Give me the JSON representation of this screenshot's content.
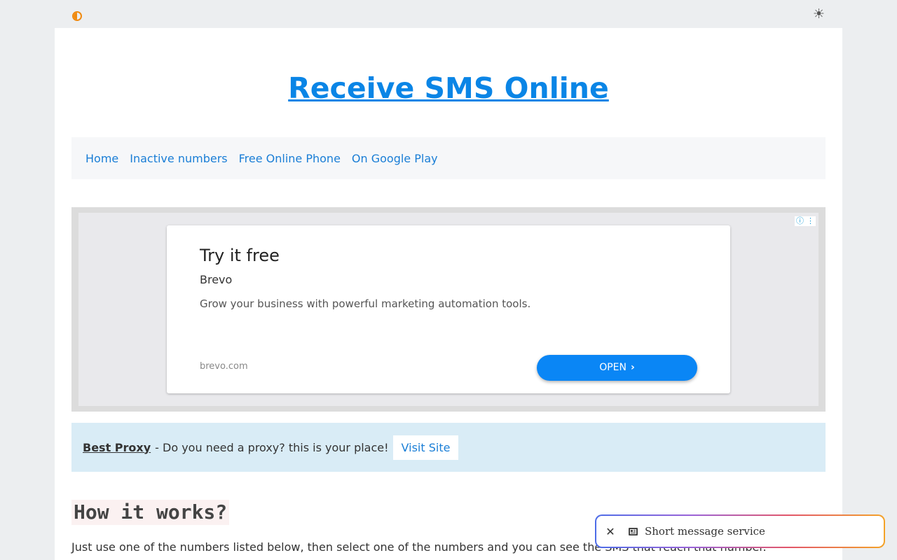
{
  "icons": {
    "contrast": "contrast-icon",
    "theme": "sun-icon",
    "close": "close-icon",
    "article": "article-icon"
  },
  "theme_toggle": {
    "glyph": "☀"
  },
  "header": {
    "title": "Receive SMS Online"
  },
  "nav": {
    "items": [
      {
        "label": "Home"
      },
      {
        "label": "Inactive numbers"
      },
      {
        "label": "Free Online Phone"
      },
      {
        "label": "On Google Play"
      }
    ]
  },
  "ad": {
    "choices_info": "ⓘ",
    "choices_menu": "⋮",
    "headline": "Try it free",
    "advertiser": "Brevo",
    "description": "Grow your business with powerful marketing automation tools.",
    "domain": "brevo.com",
    "cta": "OPEN",
    "cta_chevron": "›"
  },
  "promo": {
    "link": "Best Proxy",
    "text": "- Do you need a proxy? this is your place!",
    "button": "Visit Site"
  },
  "how_it_works": {
    "heading": "How it works?",
    "text": "Just use one of the numbers listed below, then select one of the numbers and you can see the SMS that reach that number."
  },
  "toast": {
    "close": "✕",
    "text": "Short message service"
  },
  "colors": {
    "accent": "#0a85e6",
    "link": "#1a7ed6",
    "cta": "#0a86f5",
    "promo_bg": "#d9ecf6",
    "contrast_icon": "#f08a10"
  }
}
